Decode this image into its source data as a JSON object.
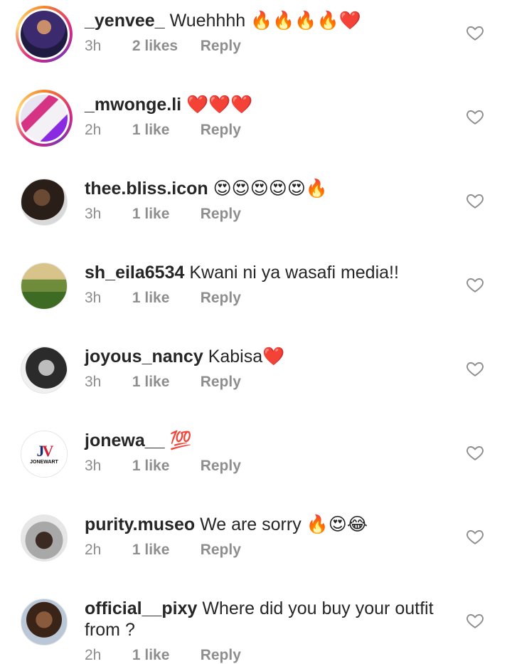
{
  "reply_label": "Reply",
  "comments": [
    {
      "username": "_yenvee_",
      "text": "Wuehhhh",
      "emoji": "🔥🔥🔥🔥❤️",
      "time": "3h",
      "likes": "2 likes",
      "avatar_story_ring": true
    },
    {
      "username": "_mwonge.li",
      "text": "",
      "emoji": "❤️❤️❤️",
      "time": "2h",
      "likes": "1 like",
      "avatar_story_ring": true
    },
    {
      "username": "thee.bliss.icon",
      "text": "",
      "emoji": "😍😍😍😍😍🔥",
      "time": "3h",
      "likes": "1 like",
      "avatar_story_ring": false
    },
    {
      "username": "sh_eila6534",
      "text": "Kwani ni ya wasafi media!!",
      "emoji": "",
      "time": "3h",
      "likes": "1 like",
      "avatar_story_ring": false
    },
    {
      "username": "joyous_nancy",
      "text": "Kabisa",
      "emoji": "❤️",
      "time": "3h",
      "likes": "1 like",
      "avatar_story_ring": false
    },
    {
      "username": "jonewa__",
      "text": "",
      "emoji": "💯",
      "time": "3h",
      "likes": "1 like",
      "avatar_story_ring": false,
      "avatar_logo_text": "JONEWART"
    },
    {
      "username": "purity.museo",
      "text": "We are sorry",
      "emoji": "🔥😍😂",
      "time": "2h",
      "likes": "1 like",
      "avatar_story_ring": false
    },
    {
      "username": "official__pixy",
      "text": "Where did you buy your outfit from ?",
      "emoji": "",
      "time": "2h",
      "likes": "1 like",
      "avatar_story_ring": false
    }
  ],
  "colors": {
    "text": "#262626",
    "meta": "#8e8e8e",
    "heart_outline": "#8e8e8e",
    "background": "#ffffff"
  }
}
